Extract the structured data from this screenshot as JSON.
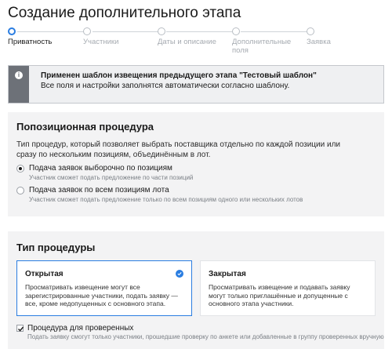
{
  "page": {
    "title": "Создание дополнительного этапа"
  },
  "stepper": {
    "steps": [
      {
        "label": "Приватность"
      },
      {
        "label": "Участники"
      },
      {
        "label": "Даты и описание"
      },
      {
        "label": "Дополнительные\nполя"
      },
      {
        "label": "Заявка"
      }
    ],
    "active_index": 0
  },
  "info": {
    "icon": "info-icon",
    "title": "Применен шаблон извещения предыдущего этапа \"Тестовый шаблон\"",
    "text": "Все поля и настройки заполнятся автоматически согласно шаблону."
  },
  "positional": {
    "title": "Попозиционная процедура",
    "description": "Тип процедур, который позволяет выбрать поставщика отдельно по каждой позиции или сразу по нескольким позициям, объединённым в лот.",
    "options": [
      {
        "label": "Подача заявок выборочно по позициям",
        "hint": "Участник сможет подать предложение по части позиций",
        "checked": true
      },
      {
        "label": "Подача заявок по всем позициям лота",
        "hint": "Участник сможет подать предложение только по всем позициям одного или нескольких лотов",
        "checked": false
      }
    ]
  },
  "procedure_type": {
    "title": "Тип процедуры",
    "options": [
      {
        "title": "Открытая",
        "description": "Просматривать извещение могут все зарегистрированные участники, подать заявку — все, кроме недопущенных с основного этапа.",
        "selected": true
      },
      {
        "title": "Закрытая",
        "description": "Просматривать извещение и подавать заявку могут только приглашённые и допущенные с основного этапа участники.",
        "selected": false
      }
    ],
    "verified": {
      "label": "Процедура для проверенных",
      "hint": "Подать заявку смогут только участники, прошедшие проверку по анкете или добавленные в группу проверенных вручную",
      "checked": true
    }
  },
  "colors": {
    "accent": "#2a7de1",
    "info_bar": "#6d7178",
    "card_bg": "#f3f3f4"
  }
}
